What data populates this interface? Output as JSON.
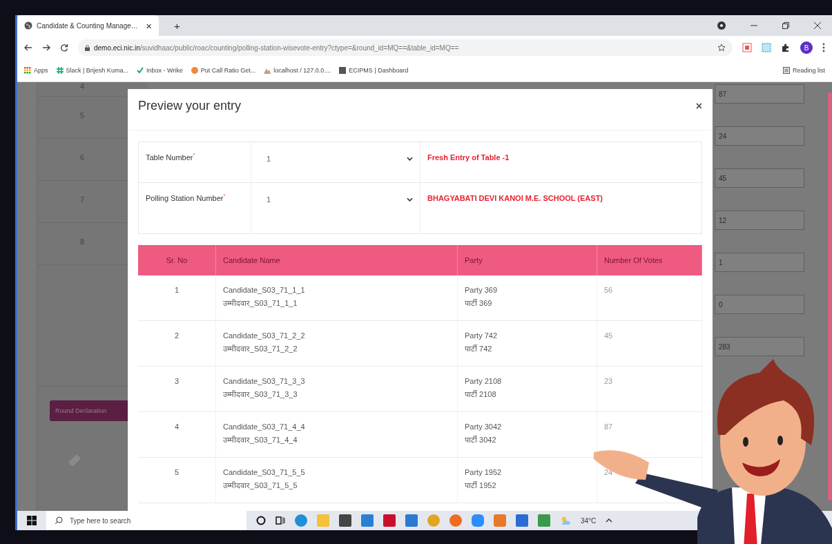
{
  "browser": {
    "tab_title": "Candidate & Counting Manage…",
    "close_tab": "×",
    "new_tab": "+",
    "url_host": "demo.eci.nic.in",
    "url_path": "/suvidhaac/public/roac/counting/polling-station-wisevote-entry?ctype=&round_id=MQ==&table_id=MQ==",
    "profile_initial": "B",
    "bookmarks": [
      {
        "label": "Apps",
        "kind": "apps"
      },
      {
        "label": "Slack | Brijesh Kuma...",
        "kind": "slack"
      },
      {
        "label": "Inbox - Wrike",
        "kind": "check"
      },
      {
        "label": "Put Call Ratio Get...",
        "kind": "dot"
      },
      {
        "label": "localhost / 127.0.0....",
        "kind": "db"
      },
      {
        "label": "ECIPMS | Dashboard",
        "kind": "square"
      }
    ],
    "reading_list": "Reading list"
  },
  "background_page": {
    "row_numbers": [
      "4",
      "5",
      "6",
      "7",
      "8"
    ],
    "vote_inputs": [
      "87",
      "24",
      "45",
      "12",
      "1",
      "0",
      "283"
    ],
    "button": "Round Declaration"
  },
  "modal": {
    "title": "Preview your entry",
    "close": "×",
    "fields": [
      {
        "label": "Table Number$^{*}$",
        "value": "1",
        "note": "Fresh Entry of Table -1"
      },
      {
        "label": "Polling Station Number$^{*}$",
        "value": "1",
        "note": "BHAGYABATI DEVI KANOI M.E. SCHOOL (EAST)"
      }
    ],
    "columns": [
      "Sr. No",
      "Candidate Name",
      "Party",
      "Number Of Votes"
    ],
    "rows": [
      {
        "sr": "1",
        "name": "Candidate_S03_71_1_1",
        "name_hi": "उम्मीदवार_S03_71_1_1",
        "party": "Party 369",
        "party_hi": "पार्टी 369",
        "votes": "56"
      },
      {
        "sr": "2",
        "name": "Candidate_S03_71_2_2",
        "name_hi": "उम्मीदवार_S03_71_2_2",
        "party": "Party 742",
        "party_hi": "पार्टी 742",
        "votes": "45"
      },
      {
        "sr": "3",
        "name": "Candidate_S03_71_3_3",
        "name_hi": "उम्मीदवार_S03_71_3_3",
        "party": "Party 2108",
        "party_hi": "पार्टी 2108",
        "votes": "23"
      },
      {
        "sr": "4",
        "name": "Candidate_S03_71_4_4",
        "name_hi": "उम्मीदवार_S03_71_4_4",
        "party": "Party 3042",
        "party_hi": "पार्टी 3042",
        "votes": "87"
      },
      {
        "sr": "5",
        "name": "Candidate_S03_71_5_5",
        "name_hi": "उम्मीदवार_S03_71_5_5",
        "party": "Party 1952",
        "party_hi": "पार्टी 1952",
        "votes": "24"
      }
    ]
  },
  "taskbar": {
    "search_placeholder": "Type here to search",
    "temperature": "34°C"
  }
}
